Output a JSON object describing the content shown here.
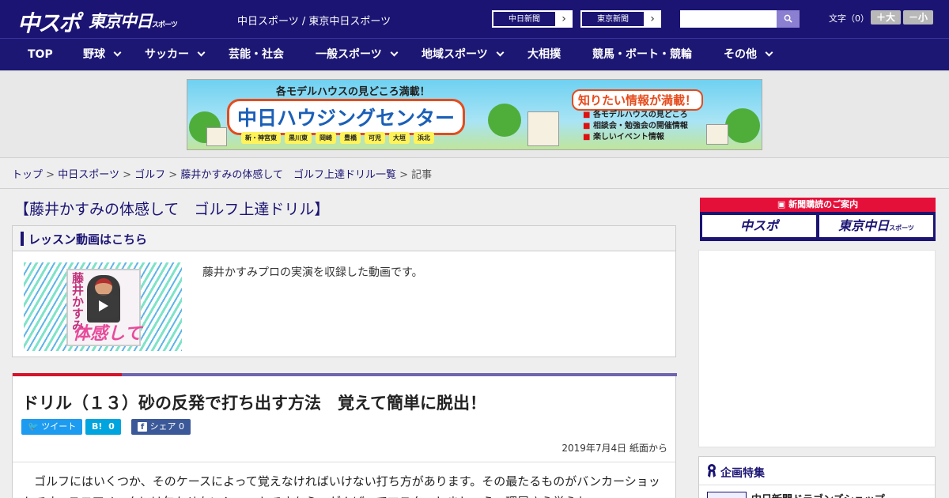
{
  "header": {
    "logo_main": "中スポ",
    "logo_tokyo": "東京中日",
    "logo_tokyo_small": "スポーツ",
    "site_links": "中日スポーツ / 東京中日スポーツ",
    "paper1": "中日新聞",
    "paper2": "東京新聞",
    "search_placeholder": "",
    "font_label": "文字（0）",
    "font_big": "＋大",
    "font_small": "－小"
  },
  "nav": {
    "items": [
      {
        "label": "TOP"
      },
      {
        "label": "野球"
      },
      {
        "label": "サッカー"
      },
      {
        "label": "芸能・社会"
      },
      {
        "label": "一般スポーツ"
      },
      {
        "label": "地域スポーツ"
      },
      {
        "label": "大相撲"
      },
      {
        "label": "競馬・ボート・競輪"
      },
      {
        "label": "その他"
      }
    ]
  },
  "banner": {
    "catch": "各モデルハウスの見どころ満載！",
    "main": "中日ハウジングセンター",
    "towns": [
      "新・神宮東",
      "黒川東",
      "岡崎",
      "豊橋",
      "可児",
      "大垣",
      "浜北"
    ],
    "info_head": "知りたい情報が満載！",
    "info": [
      "各モデルハウスの見どころ",
      "相談会・勉強会の開催情報",
      "楽しいイベント情報"
    ]
  },
  "breadcrumb": {
    "items": [
      "トップ",
      "中日スポーツ",
      "ゴルフ",
      "藤井かすみの体感して　ゴルフ上達ドリル一覧"
    ],
    "current": "記事",
    "sep": ">"
  },
  "main": {
    "series_title": "【藤井かすみの体感して　ゴルフ上達ドリル】",
    "lesson_head": "レッスン動画はこちら",
    "lesson_desc": "藤井かすみプロの実演を収録した動画です。",
    "thumb_vertical": "藤井かすみ",
    "thumb_word": "体感して",
    "article_title": "ドリル（１３）砂の反発で打ち出す方法　覚えて簡単に脱出！",
    "tweet": "ツイート",
    "hatena": "B!",
    "hatena_count": "0",
    "share": "シェア",
    "share_count": "0",
    "date": "2019年7月4日 紙面から",
    "body": "　ゴルフにはいくつか、そのケースによって覚えなければいけない打ち方があります。その最たるものがバンカーショットです。スコアメークには欠かせないショットですから、がんばってマスターしましょう。理屈さえ覚えれ"
  },
  "sidebar": {
    "sub_head": "新聞購読のご案内",
    "sub_logo1": "中スポ",
    "sub_logo2": "東京中日",
    "sub_logo2_small": "スポーツ",
    "feature_title": "企画特集",
    "feature_item": "中日新聞ドラゴンズショップ"
  },
  "colors": {
    "brand": "#1b1473",
    "accent_red": "#d8122a",
    "accent_purple": "#6f64ae"
  }
}
